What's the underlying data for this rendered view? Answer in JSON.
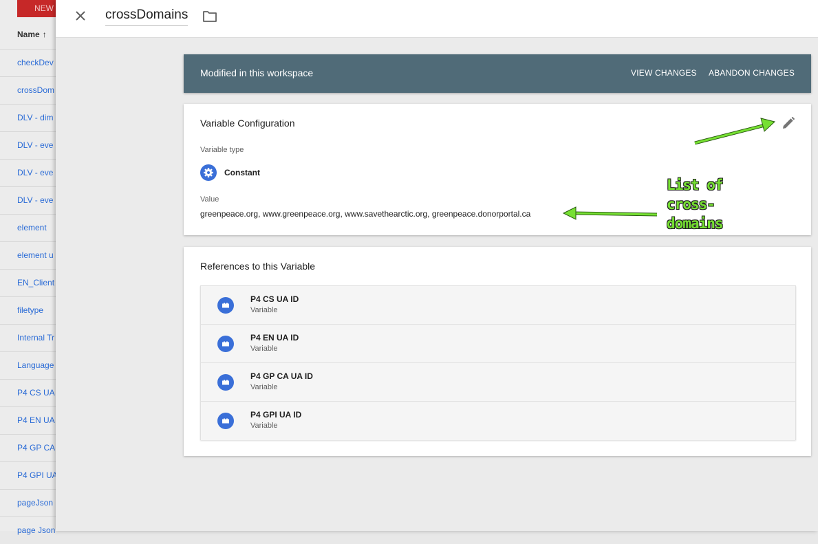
{
  "background_list": {
    "new_button": "NEW",
    "column_header": "Name",
    "sort_icon": "arrow-up-icon",
    "rows": [
      "checkDev",
      "crossDom",
      "DLV - dim",
      "DLV - eve",
      "DLV - eve",
      "DLV - eve",
      "element",
      "element u",
      "EN_Client",
      "filetype",
      "Internal Tr",
      "Language",
      "P4 CS UA",
      "P4 EN UA",
      "P4 GP CA",
      "P4 GPI UA",
      "pageJson",
      "page Json"
    ]
  },
  "header": {
    "title": "crossDomains",
    "close_icon": "close-icon",
    "folder_icon": "folder-icon"
  },
  "banner": {
    "text": "Modified in this workspace",
    "view_changes": "VIEW CHANGES",
    "abandon_changes": "ABANDON CHANGES",
    "color": "#506b78"
  },
  "config": {
    "title": "Variable Configuration",
    "edit_icon": "pencil-icon",
    "type_label": "Variable type",
    "type_icon": "gear-icon",
    "type_name": "Constant",
    "value_label": "Value",
    "value": "greenpeace.org, www.greenpeace.org, www.savethearctic.org, greenpeace.donorportal.ca"
  },
  "references": {
    "title": "References to this Variable",
    "items": [
      {
        "name": "P4 CS UA ID",
        "type": "Variable",
        "icon": "variable-icon"
      },
      {
        "name": "P4 EN UA ID",
        "type": "Variable",
        "icon": "variable-icon"
      },
      {
        "name": "P4 GP CA UA ID",
        "type": "Variable",
        "icon": "variable-icon"
      },
      {
        "name": "P4 GPI UA ID",
        "type": "Variable",
        "icon": "variable-icon"
      }
    ]
  },
  "annotation": {
    "lines": [
      "List of",
      "cross-",
      "domains"
    ],
    "color": "#76e032"
  }
}
